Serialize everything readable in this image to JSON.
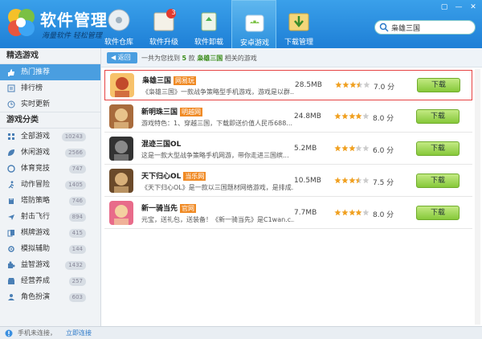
{
  "app": {
    "title": "软件管理",
    "slogan": "海量软件 轻松管理"
  },
  "window_controls": [
    "▢",
    "—",
    "✕"
  ],
  "nav": [
    {
      "label": "软件仓库",
      "icon": "disc-icon"
    },
    {
      "label": "软件升级",
      "icon": "upgrade-box-icon",
      "badge": "3"
    },
    {
      "label": "软件卸载",
      "icon": "recycle-bin-icon"
    },
    {
      "label": "安卓游戏",
      "icon": "android-bag-icon",
      "active": true
    },
    {
      "label": "下载管理",
      "icon": "download-folder-icon"
    }
  ],
  "search": {
    "value": "枭雄三国",
    "placeholder": "搜索"
  },
  "sidebar": {
    "section1": "精选游戏",
    "featured": [
      {
        "label": "热门推荐",
        "icon": "thumb-icon",
        "active": true
      },
      {
        "label": "排行榜",
        "icon": "list-icon"
      },
      {
        "label": "实时更新",
        "icon": "clock-icon"
      }
    ],
    "section2": "游戏分类",
    "categories": [
      {
        "label": "全部游戏",
        "count": "10243",
        "icon": "grid-icon"
      },
      {
        "label": "休闲游戏",
        "count": "2566",
        "icon": "leaf-icon"
      },
      {
        "label": "体育竞技",
        "count": "747",
        "icon": "ball-icon"
      },
      {
        "label": "动作冒险",
        "count": "1405",
        "icon": "runner-icon"
      },
      {
        "label": "塔防策略",
        "count": "746",
        "icon": "tower-icon"
      },
      {
        "label": "射击飞行",
        "count": "894",
        "icon": "plane-icon"
      },
      {
        "label": "棋牌游戏",
        "count": "415",
        "icon": "cards-icon"
      },
      {
        "label": "模拟辅助",
        "count": "144",
        "icon": "gear-icon"
      },
      {
        "label": "益智游戏",
        "count": "1432",
        "icon": "puzzle-icon"
      },
      {
        "label": "经营养成",
        "count": "257",
        "icon": "shop-icon"
      },
      {
        "label": "角色扮演",
        "count": "603",
        "icon": "role-icon"
      }
    ]
  },
  "content": {
    "back_label": "返回",
    "result_prefix": "一共为您找到",
    "result_count": "5",
    "result_mid": "款",
    "result_keyword": "枭雄三国",
    "result_suffix": "相关的游戏",
    "download_label": "下载",
    "games": [
      {
        "name": "枭雄三国",
        "tag": "网易玩",
        "desc": "《枭雄三国》一款战争策略型手机游戏，游戏是以群...",
        "size": "28.5MB",
        "rating": 3.5,
        "score": "7.0 分",
        "selected": true,
        "icon": "game-icon-xiaoxiong"
      },
      {
        "name": "新明珠三国",
        "tag": "明越网",
        "desc": "游戏特色：1、穿越三国，下载即送价值人民币688...",
        "size": "24.8MB",
        "rating": 4,
        "score": "8.0 分",
        "icon": "game-icon-mingzhu"
      },
      {
        "name": "混迹三国OL",
        "tag": "",
        "desc": "这是一款大型战争策略手机网游，带你走进三国缤...",
        "size": "5.2MB",
        "rating": 3,
        "score": "6.0 分",
        "icon": "game-icon-hunji"
      },
      {
        "name": "天下归心OL",
        "tag": "当乐网",
        "desc": "《天下归心OL》是一款以三国题材网络游戏，是排成...",
        "size": "10.5MB",
        "rating": 3.5,
        "score": "7.5 分",
        "icon": "game-icon-tianxia"
      },
      {
        "name": "新一骑当先",
        "tag": "官网",
        "desc": "元宝，送礼包，送装备！《新一骑当先》是C1wan.c...",
        "size": "7.7MB",
        "rating": 4,
        "score": "8.0 分",
        "icon": "game-icon-yiqi"
      }
    ]
  },
  "status": {
    "text": "手机未连接，",
    "link": "立即连接"
  },
  "colors": {
    "header": "#2a8ee2",
    "active_side": "#4a9ee0",
    "tag": "#f08a24",
    "download": "#86c83a",
    "selected_border": "#e64242"
  }
}
